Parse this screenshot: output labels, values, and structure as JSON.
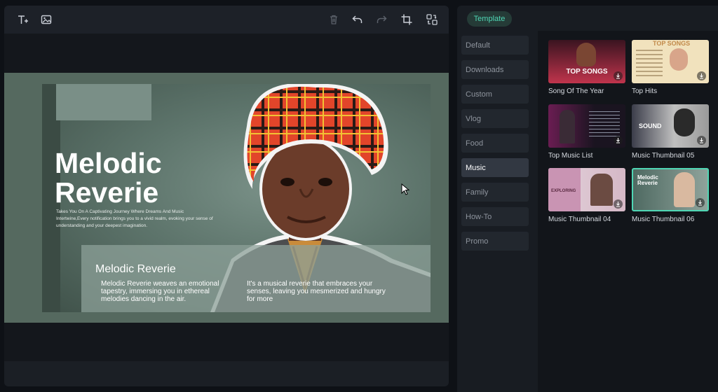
{
  "preview": {
    "title_line1": "Melodic",
    "title_line2": "Reverie",
    "description": "Takes You On A Captivating Journey Where Dreams And Music Intertwine,Every notification brings you to a vivid realm, evoking your sense of understanding and your deepest imagination.",
    "box_title": "Melodic Reverie",
    "box_col1": "Melodic Reverie weaves an emotional tapestry, immersing you in ethereal melodies dancing in the air.",
    "box_col2": "It's a musical reverie that embraces your senses, leaving you mesmerized and hungry for more"
  },
  "panel": {
    "tab_label": "Template",
    "categories": [
      "Default",
      "Downloads",
      "Custom",
      "Vlog",
      "Food",
      "Music",
      "Family",
      "How-To",
      "Promo"
    ],
    "active_category": "Music",
    "templates": [
      {
        "label": "Song Of The Year",
        "overlay": "TOP SONGS"
      },
      {
        "label": "Top Hits",
        "overlay": "TOP SONGS"
      },
      {
        "label": "Top Music List",
        "overlay": ""
      },
      {
        "label": "Music Thumbnail 05",
        "overlay": "SOUND"
      },
      {
        "label": "Music Thumbnail 04",
        "overlay": "EXPLORING"
      },
      {
        "label": "Music Thumbnail 06",
        "overlay": "Melodic Reverie"
      }
    ],
    "selected_template": "Music Thumbnail 06"
  },
  "icons": {
    "toolbar": [
      "text-add-icon",
      "image-add-icon",
      "delete-icon",
      "undo-icon",
      "redo-icon",
      "crop-icon",
      "replace-icon"
    ],
    "download": "download-icon"
  },
  "colors": {
    "accent": "#4fd6b4",
    "panel_bg": "#181c22",
    "canvas_bg": "#55695f"
  }
}
